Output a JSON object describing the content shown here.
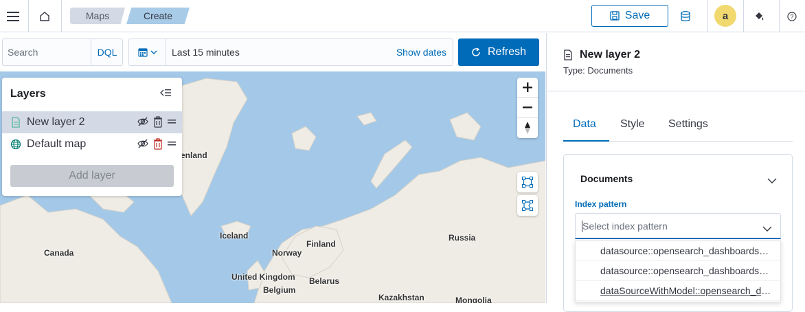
{
  "header": {
    "breadcrumbs": [
      "Maps",
      "Create"
    ],
    "save_label": "Save",
    "avatar_initial": "a"
  },
  "query": {
    "search_placeholder": "Search",
    "language": "DQL",
    "time_range": "Last 15 minutes",
    "show_dates": "Show dates",
    "refresh_label": "Refresh"
  },
  "map": {
    "places": [
      "enland",
      "Iceland",
      "Finland",
      "Russia",
      "Canada",
      "Norway",
      "United Kingdom",
      "Belarus",
      "Belgium",
      "Kazakhstan",
      "Mongolia"
    ],
    "colors": {
      "water": "#a3c8e8",
      "land": "#efece5"
    }
  },
  "layers_panel": {
    "title": "Layers",
    "items": [
      {
        "name": "New layer 2",
        "icon": "document-icon",
        "selected": true
      },
      {
        "name": "Default map",
        "icon": "globe-icon",
        "selected": false
      }
    ],
    "add_label": "Add layer"
  },
  "config_panel": {
    "title": "New layer 2",
    "subtitle": "Type: Documents",
    "tabs": [
      "Data",
      "Style",
      "Settings"
    ],
    "active_tab": "Data",
    "section_title": "Documents",
    "index_pattern_label": "Index pattern",
    "index_pattern_placeholder": "Select index pattern",
    "options": [
      "datasource::opensearch_dashboards_sample_data_ecommerce",
      "datasource::opensearch_dashboards_sample_data_flights",
      "dataSourceWithModel::opensearch_dashboards_sample_data_logs"
    ]
  },
  "accent_color": "#006bb8"
}
